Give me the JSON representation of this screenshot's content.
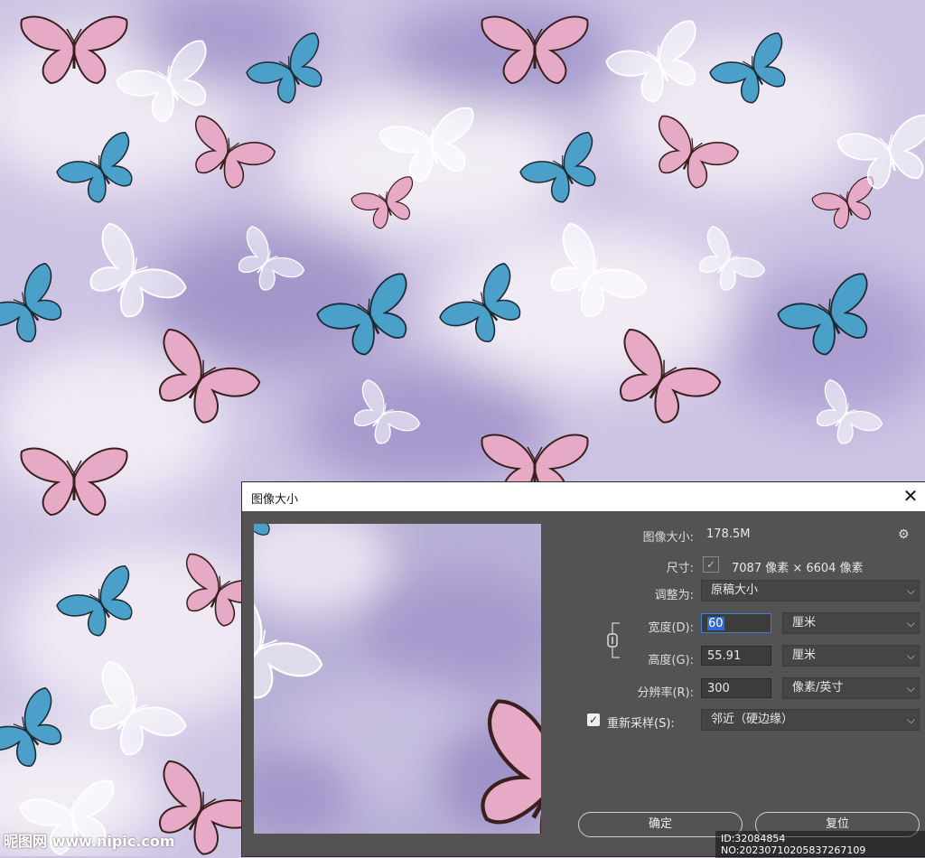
{
  "dialog": {
    "title": "图像大小",
    "close_glyph": "✕",
    "image_size_label": "图像大小:",
    "image_size_value": "178.5M",
    "dimensions_label": "尺寸:",
    "dimensions_value": "7087 像素 × 6604 像素",
    "fit_label": "调整为:",
    "fit_value": "原稿大小",
    "width_label": "宽度(D):",
    "width_value": "60",
    "width_unit": "厘米",
    "height_label": "高度(G):",
    "height_value": "55.91",
    "height_unit": "厘米",
    "resolution_label": "分辨率(R):",
    "resolution_value": "300",
    "resolution_unit": "像素/英寸",
    "resample_label": "重新采样(S):",
    "resample_value": "邻近（硬边缘）",
    "resample_checked": true,
    "ok_label": "确定",
    "reset_label": "复位",
    "gear_icon": "gear-icon",
    "chevron_icon": "chevron-down-icon",
    "link_icon": "chain-link-icon"
  },
  "watermark": {
    "left": "昵图网 www.nipic.com",
    "right": "ID:32084854 NO:20230710205837267109"
  },
  "colors": {
    "pink_butterfly": "#e6aac6",
    "blue_butterfly": "#4aa0c9",
    "white_butterfly": "#ffffff",
    "background_lavender": "#cdc3e3",
    "dialog_bg": "#535353"
  }
}
